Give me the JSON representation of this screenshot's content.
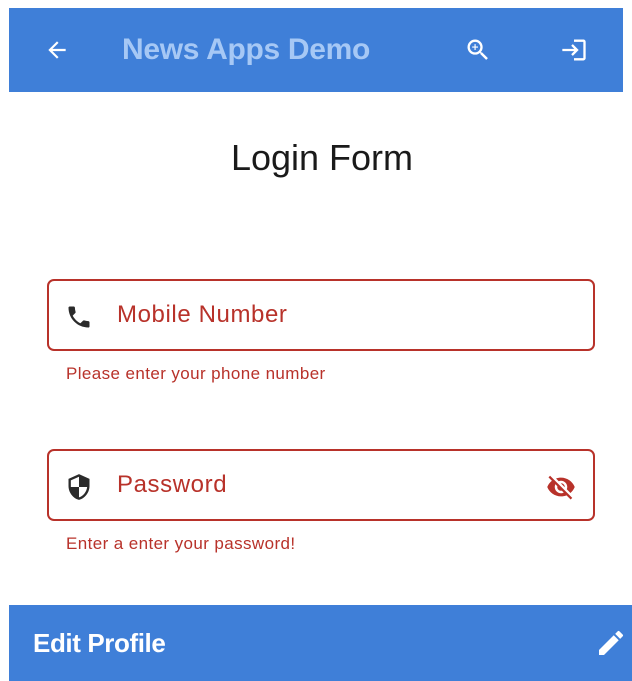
{
  "app_bar": {
    "title": "News Apps Demo",
    "back_icon": "arrow-back-icon",
    "zoom_icon": "zoom-in-icon",
    "login_icon": "login-icon",
    "background": "#3f7fd8",
    "title_color": "#a6c8f5"
  },
  "form": {
    "title": "Login Form",
    "mobile": {
      "icon": "phone-icon",
      "placeholder": "Mobile Number",
      "value": "",
      "error": "Please enter your phone number"
    },
    "password": {
      "icon": "shield-icon",
      "placeholder": "Password",
      "value": "",
      "toggle_icon": "visibility-off-icon",
      "error": "Enter a enter your password!"
    },
    "error_color": "#b8322a"
  },
  "bottom_bar": {
    "label": "Edit Profile",
    "edit_icon": "edit-pencil-icon",
    "background": "#3f7fd8"
  }
}
